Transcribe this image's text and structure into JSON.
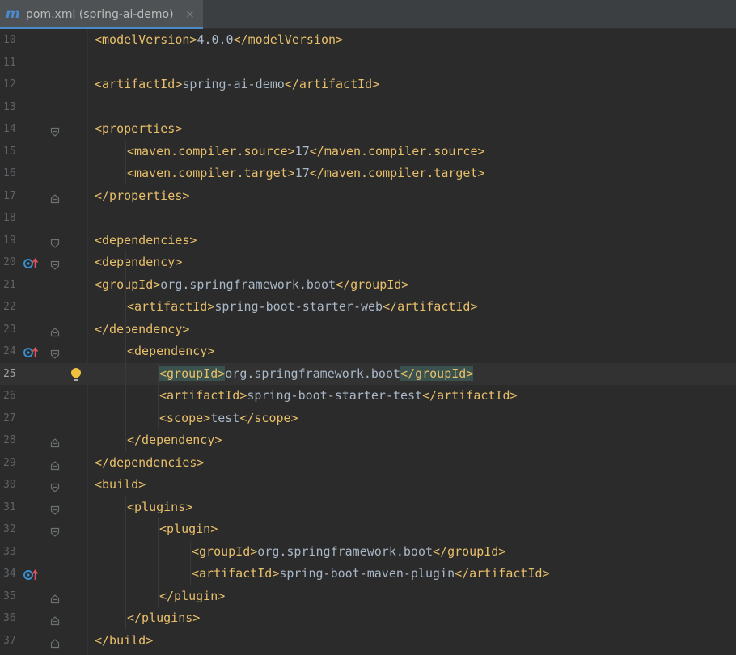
{
  "tab": {
    "icon_letter": "m",
    "label": "pom.xml (spring-ai-demo)",
    "close": "×"
  },
  "colors": {
    "tag": "#e8bf6a",
    "text": "#a9b7c6",
    "background": "#2b2b2b",
    "tab_underline": "#4a88c7"
  },
  "lines": [
    {
      "n": "10",
      "indent": 1,
      "tag_open": "<modelVersion>",
      "text": "4.0.0",
      "tag_close": "</modelVersion>"
    },
    {
      "n": "11",
      "indent": 0,
      "tag_open": "",
      "text": "",
      "tag_close": ""
    },
    {
      "n": "12",
      "indent": 1,
      "tag_open": "<artifactId>",
      "text": "spring-ai-demo",
      "tag_close": "</artifactId>"
    },
    {
      "n": "13",
      "indent": 0,
      "tag_open": "",
      "text": "",
      "tag_close": ""
    },
    {
      "n": "14",
      "indent": 1,
      "tag_open": "<properties>",
      "text": "",
      "tag_close": "",
      "fold": "open"
    },
    {
      "n": "15",
      "indent": 2,
      "tag_open": "<maven.compiler.source>",
      "text": "17",
      "tag_close": "</maven.compiler.source>"
    },
    {
      "n": "16",
      "indent": 2,
      "tag_open": "<maven.compiler.target>",
      "text": "17",
      "tag_close": "</maven.compiler.target>"
    },
    {
      "n": "17",
      "indent": 1,
      "tag_open": "</properties>",
      "text": "",
      "tag_close": "",
      "fold": "close"
    },
    {
      "n": "18",
      "indent": 0,
      "tag_open": "",
      "text": "",
      "tag_close": ""
    },
    {
      "n": "19",
      "indent": 1,
      "tag_open": "<dependencies>",
      "text": "",
      "tag_close": "",
      "fold": "open"
    },
    {
      "n": "20",
      "indent": 1,
      "tag_open": "<dependency>",
      "text": "",
      "tag_close": "",
      "fold": "open",
      "mark": true
    },
    {
      "n": "21",
      "indent": 1,
      "tag_open": "<groupId>",
      "text": "org.springframework.boot",
      "tag_close": "</groupId>"
    },
    {
      "n": "22",
      "indent": 2,
      "tag_open": "<artifactId>",
      "text": "spring-boot-starter-web",
      "tag_close": "</artifactId>"
    },
    {
      "n": "23",
      "indent": 1,
      "tag_open": "</dependency>",
      "text": "",
      "tag_close": "",
      "fold": "close"
    },
    {
      "n": "24",
      "indent": 2,
      "tag_open": "<dependency>",
      "text": "",
      "tag_close": "",
      "fold": "open",
      "mark": true
    },
    {
      "n": "25",
      "indent": 3,
      "tag_open": "<groupId>",
      "text": "org.springframework.boot",
      "tag_close": "</groupId>",
      "current": true,
      "bulb": true
    },
    {
      "n": "26",
      "indent": 3,
      "tag_open": "<artifactId>",
      "text": "spring-boot-starter-test",
      "tag_close": "</artifactId>"
    },
    {
      "n": "27",
      "indent": 3,
      "tag_open": "<scope>",
      "text": "test",
      "tag_close": "</scope>"
    },
    {
      "n": "28",
      "indent": 2,
      "tag_open": "</dependency>",
      "text": "",
      "tag_close": "",
      "fold": "close"
    },
    {
      "n": "29",
      "indent": 1,
      "tag_open": "</dependencies>",
      "text": "",
      "tag_close": "",
      "fold": "close"
    },
    {
      "n": "30",
      "indent": 1,
      "tag_open": "<build>",
      "text": "",
      "tag_close": "",
      "fold": "open"
    },
    {
      "n": "31",
      "indent": 2,
      "tag_open": "<plugins>",
      "text": "",
      "tag_close": "",
      "fold": "open"
    },
    {
      "n": "32",
      "indent": 3,
      "tag_open": "<plugin>",
      "text": "",
      "tag_close": "",
      "fold": "open"
    },
    {
      "n": "33",
      "indent": 4,
      "tag_open": "<groupId>",
      "text": "org.springframework.boot",
      "tag_close": "</groupId>"
    },
    {
      "n": "34",
      "indent": 4,
      "tag_open": "<artifactId>",
      "text": "spring-boot-maven-plugin",
      "tag_close": "</artifactId>",
      "mark": true
    },
    {
      "n": "35",
      "indent": 3,
      "tag_open": "</plugin>",
      "text": "",
      "tag_close": "",
      "fold": "close"
    },
    {
      "n": "36",
      "indent": 2,
      "tag_open": "</plugins>",
      "text": "",
      "tag_close": "",
      "fold": "close"
    },
    {
      "n": "37",
      "indent": 1,
      "tag_open": "</build>",
      "text": "",
      "tag_close": "",
      "fold": "close"
    }
  ]
}
